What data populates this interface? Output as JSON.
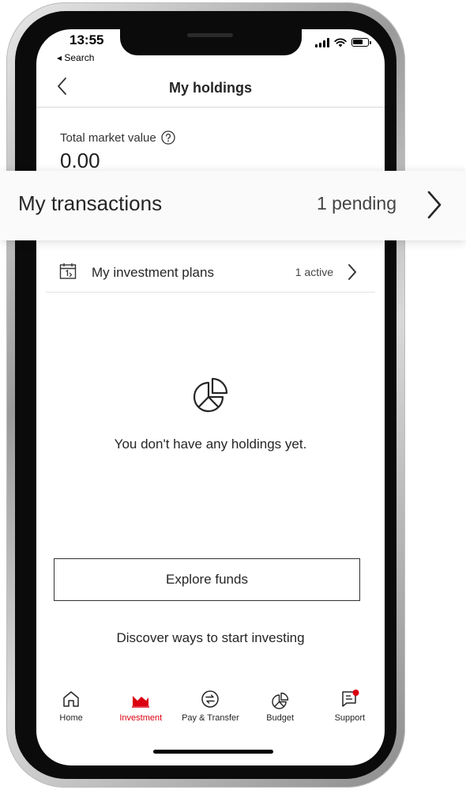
{
  "status_bar": {
    "time": "13:55",
    "back_app": "◂ Search"
  },
  "header": {
    "title": "My holdings",
    "back_icon": "chevron-left-icon"
  },
  "summary": {
    "label": "Total market value",
    "help_icon": "question-circle-icon",
    "value": "0.00"
  },
  "transactions": {
    "label": "My transactions",
    "count": "1 pending",
    "chevron_icon": "chevron-right-icon"
  },
  "plans": {
    "icon": "calendar-icon",
    "label": "My investment plans",
    "count": "1 active",
    "chevron_icon": "chevron-right-icon"
  },
  "empty_state": {
    "icon": "pie-chart-icon",
    "message": "You don't have any holdings yet."
  },
  "actions": {
    "explore_label": "Explore funds",
    "discover_label": "Discover ways to start investing"
  },
  "tabbar": {
    "items": [
      {
        "label": "Home",
        "icon": "home-icon",
        "active": false
      },
      {
        "label": "Investment",
        "icon": "chart-icon",
        "active": true
      },
      {
        "label": "Pay & Transfer",
        "icon": "transfer-icon",
        "active": false
      },
      {
        "label": "Budget",
        "icon": "pie-chart-icon",
        "active": false
      },
      {
        "label": "Support",
        "icon": "chat-icon",
        "active": false,
        "badge": true
      }
    ]
  },
  "colors": {
    "accent": "#db0011",
    "text": "#262626",
    "divider": "#d7d7d7"
  }
}
